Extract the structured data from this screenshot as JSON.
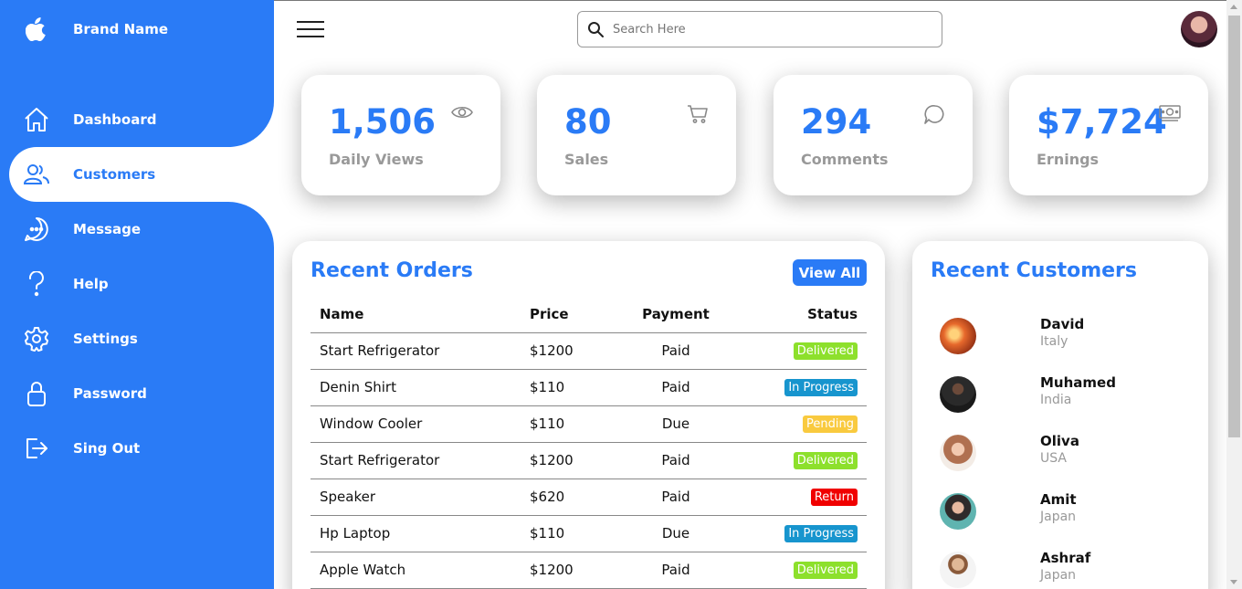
{
  "sidebar": {
    "brand": {
      "label": "Brand Name",
      "icon": "apple-logo-icon"
    },
    "items": [
      {
        "label": "Dashboard",
        "icon": "home-icon"
      },
      {
        "label": "Customers",
        "icon": "people-icon",
        "active": true
      },
      {
        "label": "Message",
        "icon": "chat-icon"
      },
      {
        "label": "Help",
        "icon": "help-icon"
      },
      {
        "label": "Settings",
        "icon": "gear-icon"
      },
      {
        "label": "Password",
        "icon": "lock-icon"
      },
      {
        "label": "Sing Out",
        "icon": "sign-out-icon"
      }
    ]
  },
  "topbar": {
    "menu_icon": "hamburger-menu-icon",
    "search": {
      "placeholder": "Search Here",
      "icon": "search-icon"
    },
    "avatar": "user-avatar"
  },
  "cards": [
    {
      "number": "1,506",
      "name": "Daily Views",
      "icon": "eye-icon"
    },
    {
      "number": "80",
      "name": "Sales",
      "icon": "cart-icon"
    },
    {
      "number": "294",
      "name": "Comments",
      "icon": "comment-icon"
    },
    {
      "number": "$7,724",
      "name": "Ernings",
      "icon": "cash-icon"
    }
  ],
  "orders": {
    "title": "Recent Orders",
    "view_all": "View All",
    "headers": {
      "name": "Name",
      "price": "Price",
      "payment": "Payment",
      "status": "Status"
    },
    "rows": [
      {
        "name": "Start Refrigerator",
        "price": "$1200",
        "payment": "Paid",
        "status": "Delivered"
      },
      {
        "name": "Denin Shirt",
        "price": "$110",
        "payment": "Paid",
        "status": "In Progress"
      },
      {
        "name": "Window Cooler",
        "price": "$110",
        "payment": "Due",
        "status": "Pending"
      },
      {
        "name": "Start Refrigerator",
        "price": "$1200",
        "payment": "Paid",
        "status": "Delivered"
      },
      {
        "name": "Speaker",
        "price": "$620",
        "payment": "Paid",
        "status": "Return"
      },
      {
        "name": "Hp Laptop",
        "price": "$110",
        "payment": "Due",
        "status": "In Progress"
      },
      {
        "name": "Apple Watch",
        "price": "$1200",
        "payment": "Paid",
        "status": "Delivered"
      }
    ]
  },
  "customers": {
    "title": "Recent Customers",
    "list": [
      {
        "name": "David",
        "country": "Italy"
      },
      {
        "name": "Muhamed",
        "country": "India"
      },
      {
        "name": "Oliva",
        "country": "USA"
      },
      {
        "name": "Amit",
        "country": "Japan"
      },
      {
        "name": "Ashraf",
        "country": "Japan"
      }
    ]
  },
  "colors": {
    "accent": "#2a7bf6",
    "delivered": "#8de02c",
    "in_progress": "#1795ce",
    "pending": "#f9ca3f",
    "return": "#f00000"
  }
}
